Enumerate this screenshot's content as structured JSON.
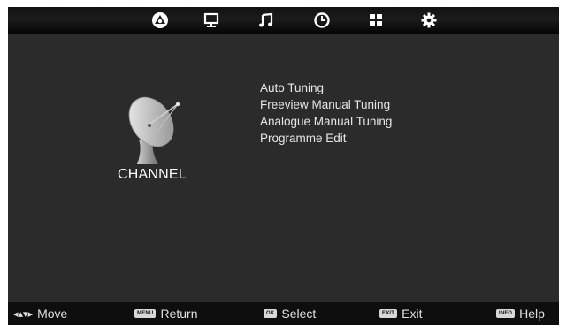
{
  "top_tabs": [
    {
      "name": "channel-tab",
      "icon": "satellite-icon"
    },
    {
      "name": "picture-tab",
      "icon": "monitor-icon"
    },
    {
      "name": "sound-tab",
      "icon": "music-note-icon"
    },
    {
      "name": "time-tab",
      "icon": "clock-icon"
    },
    {
      "name": "lock-tab",
      "icon": "grid-icon"
    },
    {
      "name": "setup-tab",
      "icon": "gear-icon"
    }
  ],
  "section": {
    "title": "CHANNEL",
    "icon": "satellite-dish-icon"
  },
  "menu": {
    "items": [
      "Auto Tuning",
      "Freeview Manual Tuning",
      "Analogue Manual Tuning",
      "Programme Edit"
    ]
  },
  "footer": {
    "move": {
      "key_icon": "arrows-icon",
      "label": "Move"
    },
    "return": {
      "key": "MENU",
      "label": "Return"
    },
    "select": {
      "key": "OK",
      "label": "Select"
    },
    "exit": {
      "key": "EXIT",
      "label": "Exit"
    },
    "help": {
      "key": "INFO",
      "label": "Help"
    }
  },
  "colors": {
    "background": "#2b2b2b",
    "bar": "#0e0e0e",
    "text": "#e6e6e6"
  }
}
